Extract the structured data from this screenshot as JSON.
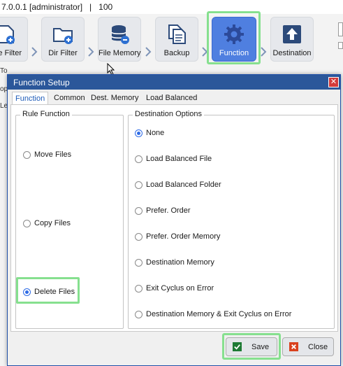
{
  "window": {
    "title_fragment": "7.0.0.1 [administrator]   |   100"
  },
  "toolbar": {
    "items": [
      {
        "label": "e Filter",
        "icon": "file-filter-icon"
      },
      {
        "label": "Dir Filter",
        "icon": "folder-plus-icon"
      },
      {
        "label": "File Memory",
        "icon": "database-icon"
      },
      {
        "label": "Backup",
        "icon": "backup-documents-icon"
      },
      {
        "label": "Function",
        "icon": "gear-icon",
        "active": true
      },
      {
        "label": "Destination",
        "icon": "upload-icon"
      }
    ]
  },
  "side_fragments": {
    "a": "To",
    "b": "op",
    "c": "Le"
  },
  "dialog": {
    "title": "Function Setup",
    "close_glyph": "✕",
    "tabs": [
      {
        "label": "Function",
        "active": true
      },
      {
        "label": "Common"
      },
      {
        "label": "Dest. Memory"
      },
      {
        "label": "Load Balanced"
      }
    ],
    "rule_function": {
      "legend": "Rule Function",
      "options": [
        {
          "label": "Move Files",
          "checked": false
        },
        {
          "label": "Copy Files",
          "checked": false
        },
        {
          "label": "Delete Files",
          "checked": true
        }
      ]
    },
    "destination_options": {
      "legend": "Destination Options",
      "options": [
        {
          "label": "None",
          "checked": true
        },
        {
          "label": "Load Balanced File",
          "checked": false
        },
        {
          "label": "Load Balanced Folder",
          "checked": false
        },
        {
          "label": "Prefer. Order",
          "checked": false
        },
        {
          "label": "Prefer. Order Memory",
          "checked": false
        },
        {
          "label": "Destination Memory",
          "checked": false
        },
        {
          "label": "Exit Cyclus on Error",
          "checked": false
        },
        {
          "label": "Destination Memory & Exit Cyclus on Error",
          "checked": false
        }
      ]
    },
    "buttons": {
      "save": "Save",
      "close": "Close"
    }
  },
  "colors": {
    "accent": "#4f7fe0",
    "dialog_title_bar": "#2b579a",
    "highlight": "#86e08f",
    "close_red": "#d23b3b"
  }
}
